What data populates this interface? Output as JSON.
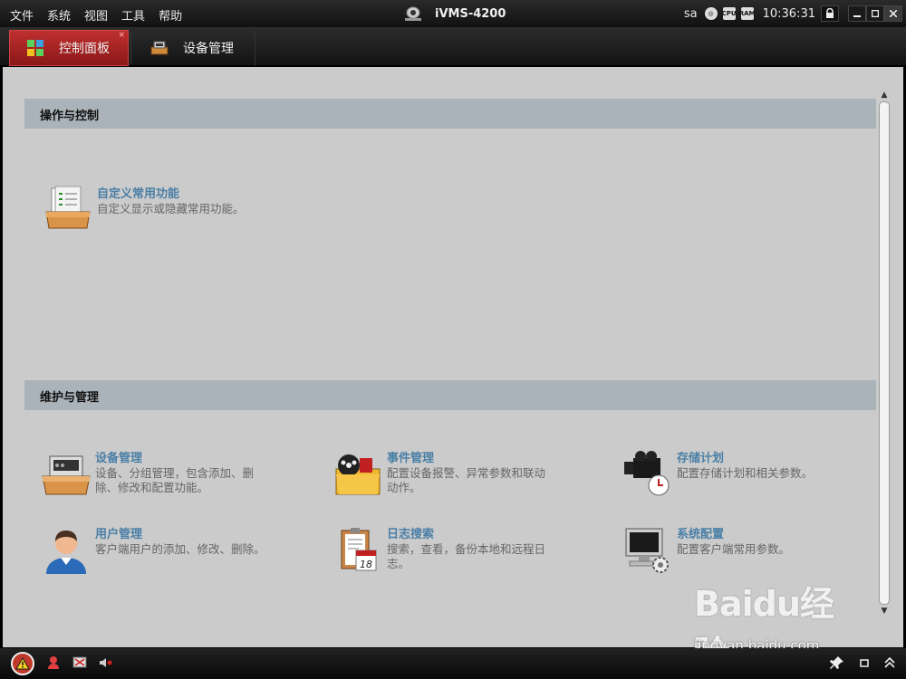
{
  "menu": [
    "文件",
    "系统",
    "视图",
    "工具",
    "帮助"
  ],
  "app_title": "iVMS-4200",
  "status": {
    "user": "sa",
    "cpu_label": "CPU",
    "ram_label": "RAM",
    "time": "10:36:31"
  },
  "tabs": [
    {
      "label": "控制面板",
      "close": "×"
    },
    {
      "label": "设备管理"
    }
  ],
  "sections": {
    "ops": {
      "title": "操作与控制",
      "items": [
        {
          "title": "自定义常用功能",
          "desc": "自定义显示或隐藏常用功能。",
          "icon": "tray-checklist-icon"
        }
      ]
    },
    "maint": {
      "title": "维护与管理",
      "items": [
        {
          "title": "设备管理",
          "desc1": "设备、分组管理，包含添加、删",
          "desc2": "除、修改和配置功能。",
          "icon": "device-tray-icon"
        },
        {
          "title": "事件管理",
          "desc1": "配置设备报警、异常参数和联动",
          "desc2": "动作。",
          "icon": "event-folder-icon"
        },
        {
          "title": "存储计划",
          "desc1": "配置存储计划和相关参数。",
          "icon": "camera-clock-icon"
        },
        {
          "title": "用户管理",
          "desc1": "客户端用户的添加、修改、删除。",
          "icon": "user-icon"
        },
        {
          "title": "日志搜索",
          "desc1": "搜索，查看，备份本地和远程日",
          "desc2": "志。",
          "calendar_day": "18",
          "icon": "clipboard-calendar-icon"
        },
        {
          "title": "系统配置",
          "desc1": "配置客户端常用参数。",
          "icon": "monitor-gear-icon"
        }
      ]
    }
  },
  "watermark": {
    "logo": "Baidu经验",
    "url": "jingyan.baidu.com"
  },
  "colors": {
    "active_tab": "#b02828",
    "section_header": "#a9b3b9",
    "item_title": "#4a7fa6"
  }
}
